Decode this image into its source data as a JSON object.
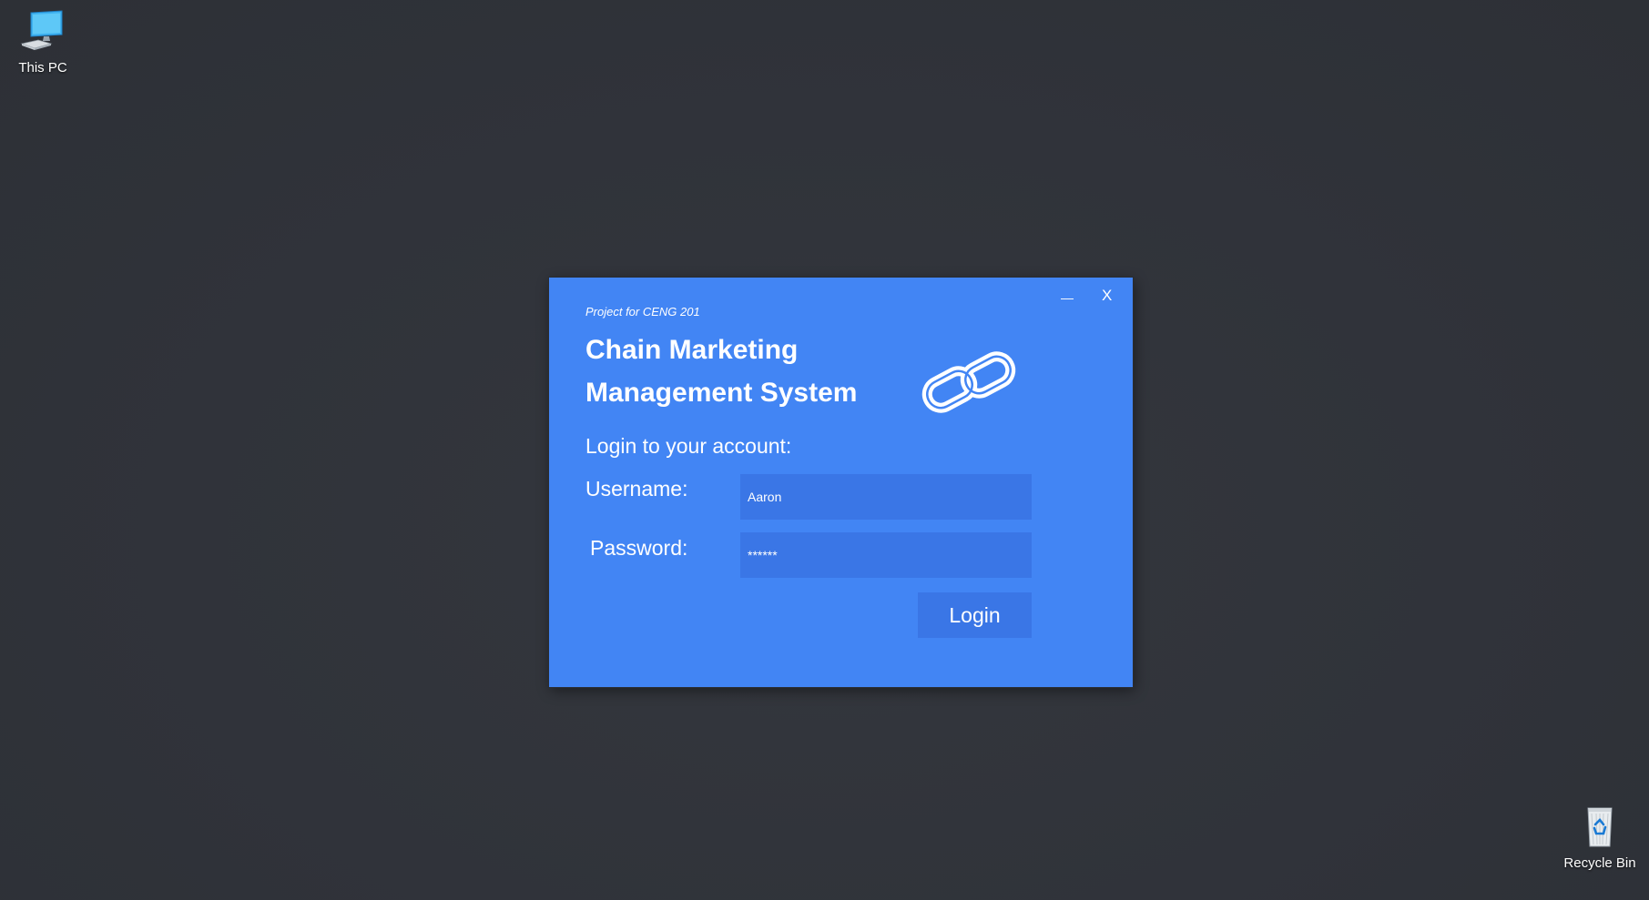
{
  "desktop": {
    "icons": [
      {
        "label": "This PC",
        "icon": "computer-icon"
      },
      {
        "label": "Recycle Bin",
        "icon": "recycle-bin-icon"
      }
    ]
  },
  "window": {
    "minimize_label": "—",
    "close_label": "X",
    "subtitle": "Project for CENG 201",
    "title_line1": "Chain Marketing",
    "title_line2": "Management System",
    "logo_icon": "chain-link-icon",
    "prompt": "Login to your account:",
    "username_label": "Username:",
    "username_value": "Aaron",
    "password_label": "Password:",
    "password_value": "******",
    "login_label": "Login",
    "colors": {
      "window_bg": "#4285f4",
      "field_bg": "#3a76e6",
      "desktop_bg": "#31343a"
    }
  }
}
